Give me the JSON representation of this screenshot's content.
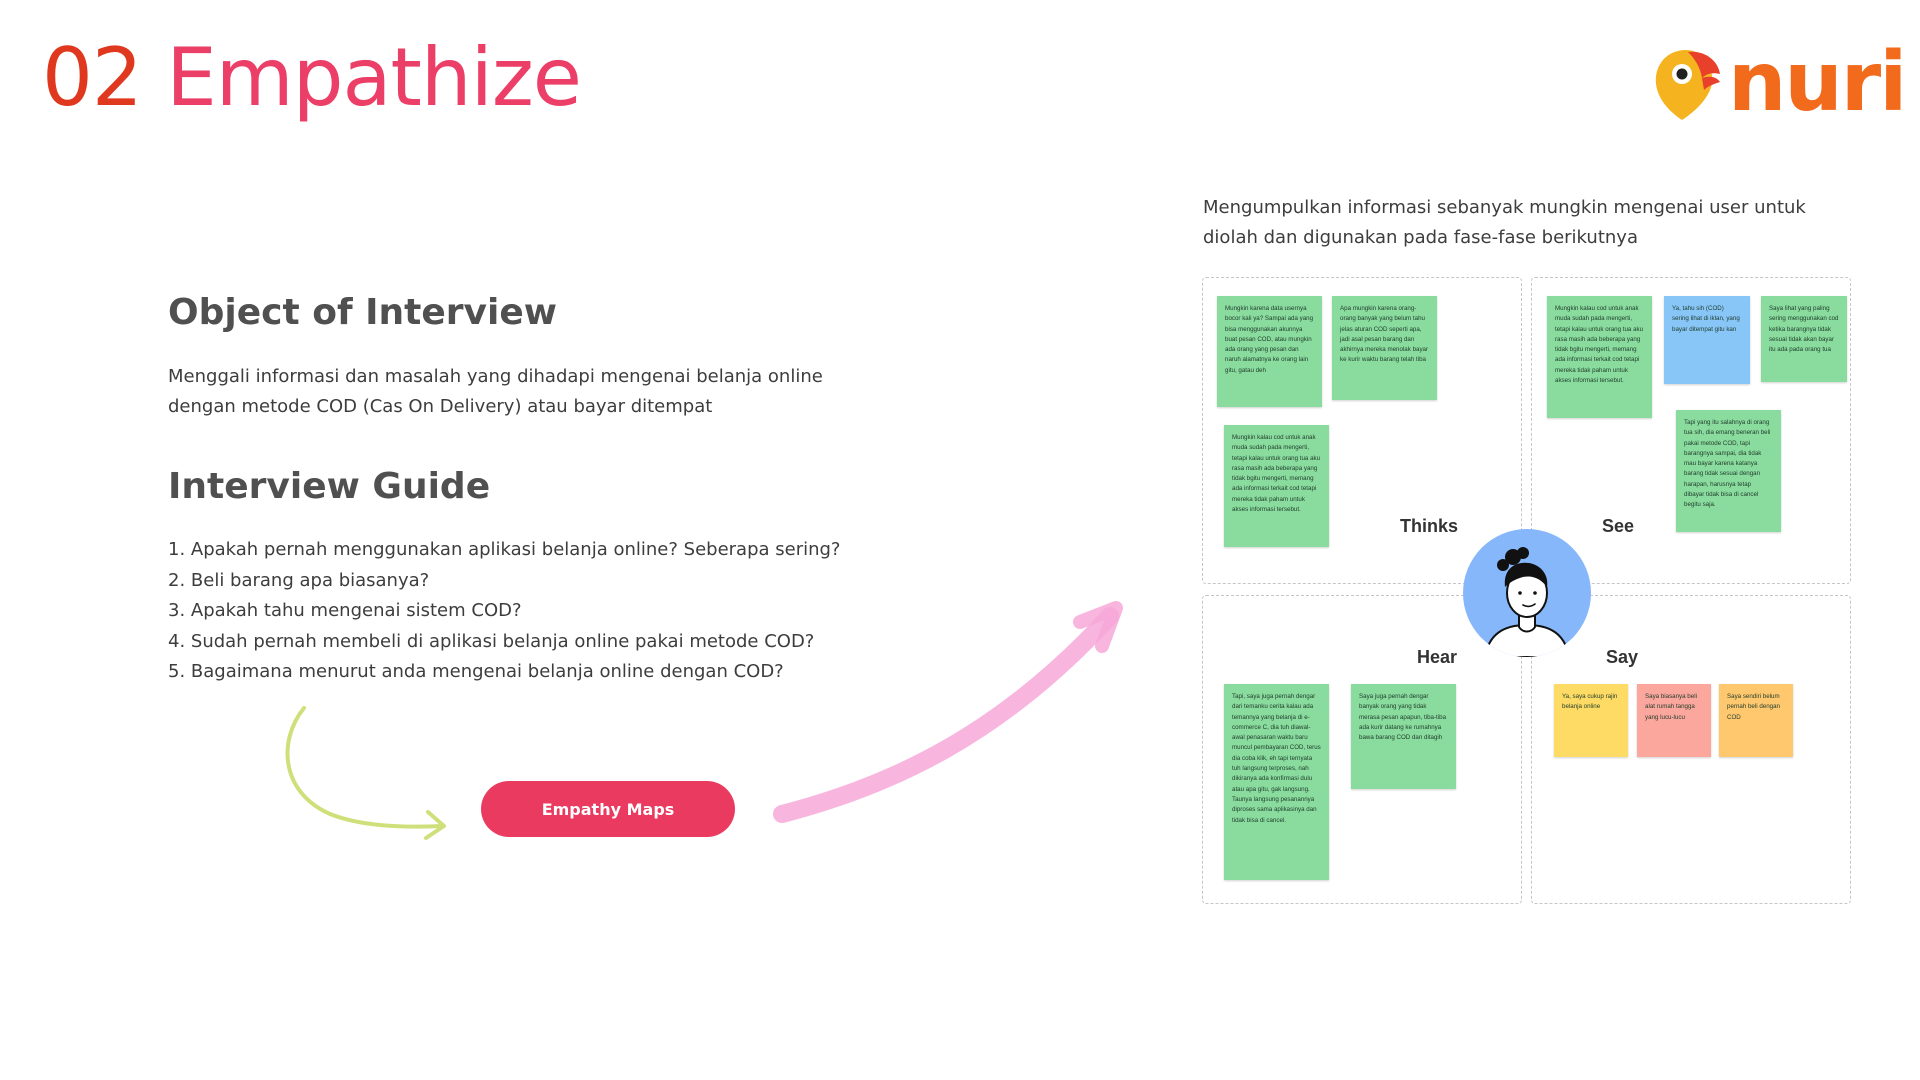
{
  "title": {
    "number": "02",
    "word": "Empathize"
  },
  "logo": {
    "text": "nuri"
  },
  "object_interview": {
    "heading": "Object of Interview",
    "description": "Menggali informasi dan masalah yang dihadapi mengenai belanja online dengan metode COD (Cas On Delivery) atau bayar ditempat"
  },
  "interview_guide": {
    "heading": "Interview Guide",
    "items": [
      "1. Apakah pernah menggunakan aplikasi belanja online? Seberapa sering?",
      "2. Beli barang apa biasanya?",
      "3. Apakah tahu mengenai sistem COD?",
      "4. Sudah pernah membeli di aplikasi belanja online pakai metode COD?",
      "5. Bagaimana menurut anda mengenai belanja online dengan COD?"
    ]
  },
  "button": {
    "label": "Empathy Maps"
  },
  "intro": "Mengumpulkan informasi sebanyak mungkin mengenai user untuk diolah dan digunakan pada fase-fase berikutnya",
  "empathy_map": {
    "labels": {
      "thinks": "Thinks",
      "see": "See",
      "hear": "Hear",
      "say": "Say"
    },
    "thinks_notes": [
      "Mungkin karena data usernya bocor kali ya? Sampai ada yang bisa menggunakan akunnya buat pesan COD, atau mungkin ada orang yang pesan dan naruh alamatnya ke orang lain gitu, gatau deh",
      "Apa mungkin karena orang-orang banyak yang belum tahu jelas aturan COD seperti apa, jadi asal pesan barang dan akhirnya mereka menolak bayar ke kurir waktu barang telah tiba",
      "Mungkin kalau cod untuk anak muda sudah pada mengerti, tetapi kalau untuk orang tua aku rasa masih ada beberapa yang tidak bgitu mengerti, memang ada informasi terkait cod tetapi mereka tidak paham untuk akses informasi tersebut."
    ],
    "see_notes": [
      "Mungkin kalau cod untuk anak muda sudah pada mengerti, tetapi kalau untuk orang tua aku rasa masih ada beberapa yang tidak bgitu mengerti, memang ada informasi terkait cod tetapi mereka tidak paham untuk akses informasi tersebut.",
      "Ya, tahu sih (COD) sering lihat di iklan, yang bayar ditempat gitu kan",
      "Saya lihat yang paling sering menggunakan cod ketika barangnya tidak sesuai tidak akan bayar itu ada pada orang tua",
      "Tapi yang itu salahnya di orang tua sih, dia emang beneran beli pakai metode COD, tapi barangnya sampai, dia tidak mau bayar karena katanya barang tidak sesuai dengan harapan, harusnya tetap dibayar tidak bisa di cancel begitu saja."
    ],
    "hear_notes": [
      "Tapi, saya juga pernah dengar dari temanku cerita kalau ada temannya yang belanja di e-commerce C, dia tuh diawal-awal penasaran waktu baru muncul pembayaran COD, terus dia coba klik, eh tapi ternyata tuh langsung terproses, nah dikiranya ada konfirmasi dulu atau apa gitu, gak langsung. Taunya langsung pesanannya diproses sama aplikasinya dan tidak bisa di cancel.",
      "Saya juga pernah dengar banyak orang yang tidak merasa pesan apapun, tiba-tiba ada kurir datang ke rumahnya bawa barang COD dan ditagih"
    ],
    "say_notes": [
      "Ya, saya cukup rajin belanja online",
      "Saya biasanya beli alat rumah tangga yang lucu-lucu",
      "Saya sendiri belum pernah beli dengan COD"
    ]
  },
  "colors": {
    "title_number": "#e0381e",
    "title_word": "#ec3f68",
    "button": "#eb3a5f",
    "logo": "#f26a1b",
    "note_green": "#8adb9e",
    "note_blue": "#88c6f8",
    "note_yellow": "#fedb64",
    "note_pink": "#fba79d",
    "note_orange": "#ffc86f",
    "avatar_bg": "#86b7fb"
  }
}
